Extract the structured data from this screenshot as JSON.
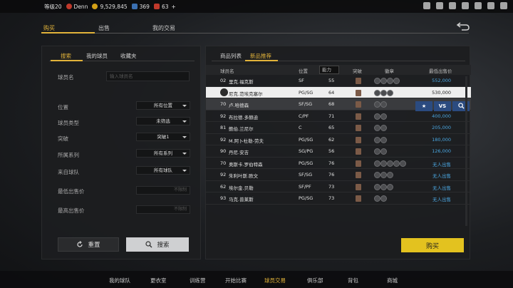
{
  "topbar": {
    "level": "等级20",
    "username": "Denn",
    "coins": "9,529,845",
    "vc": "369",
    "tokens": "63",
    "plus": "+"
  },
  "main_tabs": [
    "购买",
    "出售",
    "我的交易"
  ],
  "left_panel": {
    "tabs": [
      "搜索",
      "我的球员",
      "收藏夹"
    ],
    "fields": {
      "player_name_label": "球员名",
      "player_name_placeholder": "输入球员名",
      "position_label": "位置",
      "position_value": "所有位置",
      "type_label": "球员类型",
      "type_value": "未筛选",
      "break_label": "突破",
      "break_value": "突破1",
      "series_label": "所属系列",
      "series_value": "所有系列",
      "team_label": "来自球队",
      "team_value": "所有球队",
      "min_price_label": "最低出售价",
      "min_price_placeholder": "不限制",
      "max_price_label": "最高出售价",
      "max_price_placeholder": "不限制"
    },
    "reset_label": "重置",
    "search_label": "搜索"
  },
  "right_panel": {
    "tabs": [
      "商品列表",
      "新品推荐"
    ],
    "headers": {
      "name": "球员名",
      "position": "位置",
      "ability": "能力",
      "break": "突破",
      "badges": "徽章",
      "price": "最低出售价"
    },
    "rows": [
      {
        "rank": "02",
        "name": "里克.福克斯",
        "pos": "SF",
        "ability": "55",
        "price": "552,000"
      },
      {
        "rank": "",
        "name": "尼克.范埃克塞尔",
        "pos": "PG/SG",
        "ability": "64",
        "price": "530,000"
      },
      {
        "rank": "70",
        "name": "卢.哈德森",
        "pos": "SF/SG",
        "ability": "68",
        "price": ""
      },
      {
        "rank": "92",
        "name": "布拉德.多赫迪",
        "pos": "C/PF",
        "ability": "71",
        "price": "400,000"
      },
      {
        "rank": "81",
        "name": "鲍伯.兰尼尔",
        "pos": "C",
        "ability": "65",
        "price": "205,000"
      },
      {
        "rank": "92",
        "name": "M.阿卜杜勒-劳夫",
        "pos": "PG/SG",
        "ability": "62",
        "price": "180,000"
      },
      {
        "rank": "90",
        "name": "丹尼.安吉",
        "pos": "SG/PG",
        "ability": "56",
        "price": "126,000"
      },
      {
        "rank": "70",
        "name": "奥斯卡.罗伯特森",
        "pos": "PG/SG",
        "ability": "76",
        "price": "无人出售"
      },
      {
        "rank": "92",
        "name": "朱利叶斯.欧文",
        "pos": "SF/SG",
        "ability": "76",
        "price": "无人出售"
      },
      {
        "rank": "62",
        "name": "埃尔金.贝勒",
        "pos": "SF/PF",
        "ability": "73",
        "price": "无人出售"
      },
      {
        "rank": "93",
        "name": "马克.普莱斯",
        "pos": "PG/SG",
        "ability": "73",
        "price": "无人出售"
      }
    ],
    "vs_label": "VS",
    "buy_label": "购买"
  },
  "bottom_nav": [
    "我的球队",
    "更衣室",
    "训练营",
    "开始比赛",
    "球员交易",
    "俱乐部",
    "背包",
    "商城"
  ],
  "colors": {
    "accent": "#e2b33a",
    "buy": "#e3c21f",
    "price": "#4aa6e0"
  }
}
